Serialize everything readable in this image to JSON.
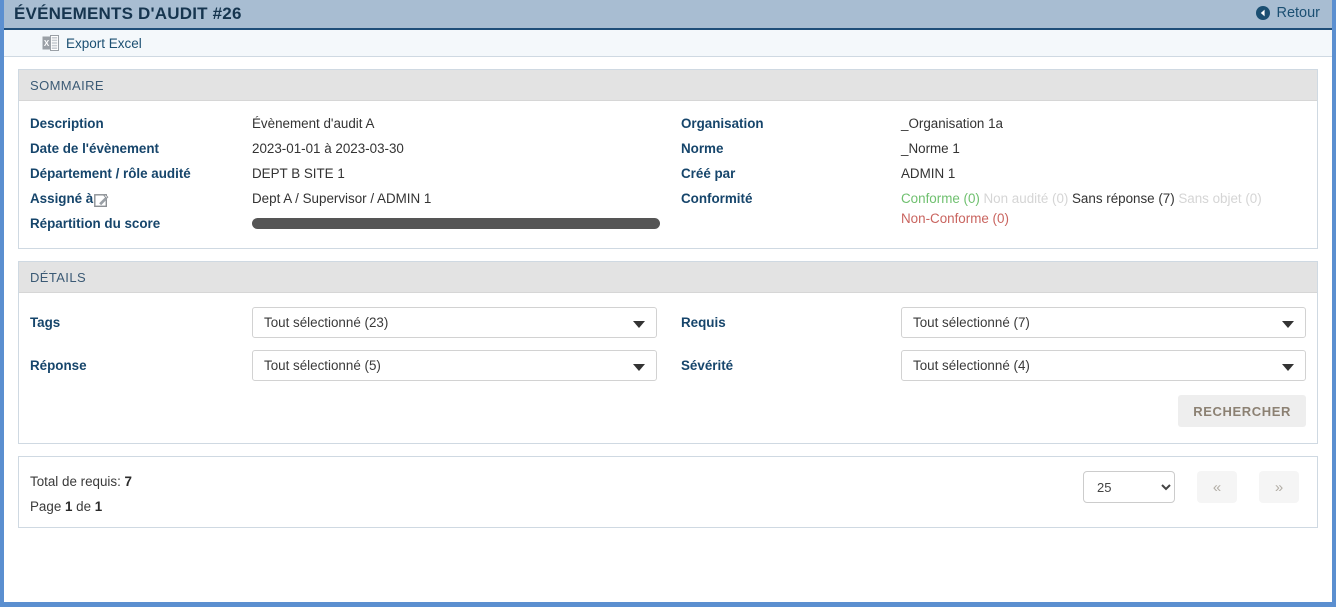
{
  "titlebar": {
    "title": "ÉVÉNEMENTS D'AUDIT #26",
    "back_label": "Retour",
    "back_icon": "circle-left-arrow-icon"
  },
  "toolbar": {
    "export_label": "Export Excel",
    "export_icon": "excel-file-icon"
  },
  "summary": {
    "panel_title": "SOMMAIRE",
    "left": [
      {
        "label": "Description",
        "value": "Évènement d'audit A"
      },
      {
        "label": "Date de l'évènement",
        "value": "2023-01-01 à 2023-03-30"
      },
      {
        "label": "Département / rôle audité",
        "value": "DEPT B SITE 1"
      },
      {
        "label": "Assigné à",
        "value": "Dept A / Supervisor / ADMIN 1",
        "icon": "edit-pencil-icon"
      },
      {
        "label": "Répartition du score",
        "value": ""
      }
    ],
    "right": [
      {
        "label": "Organisation",
        "value": "_Organisation 1a"
      },
      {
        "label": "Norme",
        "value": "_Norme 1"
      },
      {
        "label": "Créé par",
        "value": "ADMIN 1"
      }
    ],
    "conformity": {
      "label": "Conformité",
      "items": [
        {
          "text": "Conforme (0)",
          "color": "#6fc06f"
        },
        {
          "text": "Non audité (0)",
          "color": "#d5d5d5"
        },
        {
          "text": "Sans réponse (7)",
          "color": "#333333"
        },
        {
          "text": "Sans objet (0)",
          "color": "#d5d5d5"
        },
        {
          "text": "Non-Conforme (0)",
          "color": "#c9645f"
        }
      ]
    },
    "score_bar": {
      "segments": [
        {
          "name": "sans-reponse",
          "percent": 100,
          "color": "#555555"
        }
      ]
    }
  },
  "details": {
    "panel_title": "DÉTAILS",
    "fields": [
      {
        "label": "Tags",
        "value": "Tout sélectionné (23)"
      },
      {
        "label": "Requis",
        "value": "Tout sélectionné (7)"
      },
      {
        "label": "Réponse",
        "value": "Tout sélectionné (5)"
      },
      {
        "label": "Sévérité",
        "value": "Tout sélectionné (4)"
      }
    ],
    "search_label": "RECHERCHER"
  },
  "footer": {
    "total_prefix": "Total de requis: ",
    "total_value": "7",
    "page_prefix": "Page ",
    "page_current": "1",
    "page_mid": " de ",
    "page_total": "1",
    "page_size_value": "25",
    "page_size_options": [
      "25"
    ],
    "first_label": "«",
    "last_label": "»"
  }
}
